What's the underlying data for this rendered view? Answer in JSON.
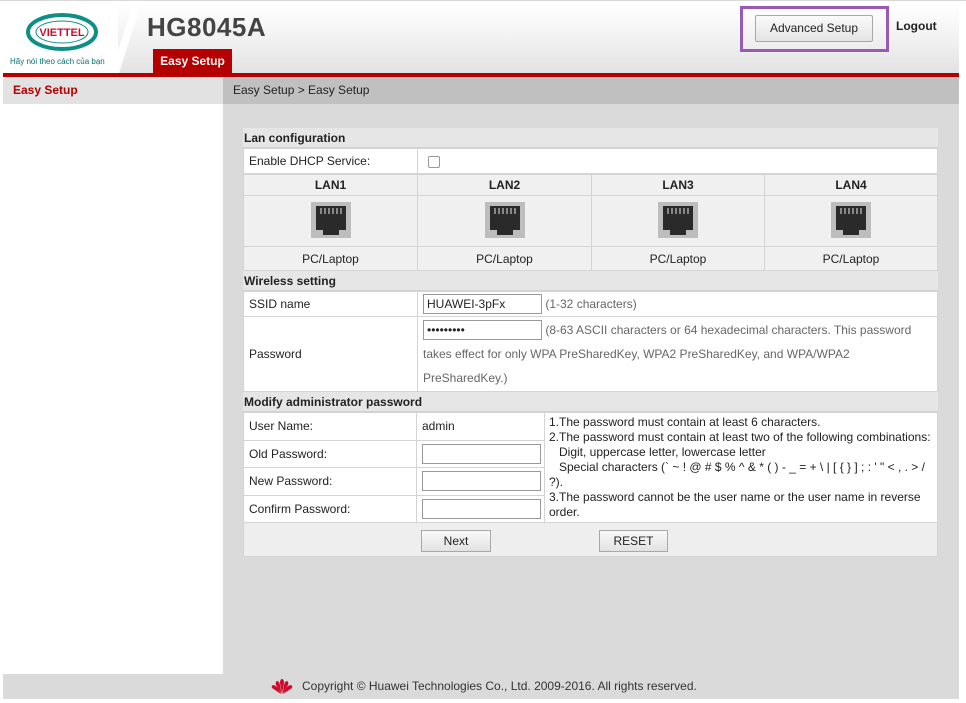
{
  "brand": {
    "logo_text": "VIETTEL",
    "slogan": "Hãy nói theo cách của bạn",
    "model": "HG8045A"
  },
  "tabs": [
    {
      "label": "Easy Setup",
      "active": true
    }
  ],
  "header_actions": {
    "advanced_setup_label": "Advanced Setup",
    "logout_label": "Logout"
  },
  "sidebar": {
    "items": [
      {
        "label": "Easy Setup",
        "active": true
      }
    ]
  },
  "breadcrumb": "Easy Setup > Easy Setup",
  "lan_config": {
    "title": "Lan configuration",
    "dhcp_label": "Enable DHCP Service:",
    "dhcp_checked": false,
    "ports": [
      {
        "name": "LAN1",
        "device": "PC/Laptop"
      },
      {
        "name": "LAN2",
        "device": "PC/Laptop"
      },
      {
        "name": "LAN3",
        "device": "PC/Laptop"
      },
      {
        "name": "LAN4",
        "device": "PC/Laptop"
      }
    ]
  },
  "wireless": {
    "title": "Wireless setting",
    "ssid_label": "SSID name",
    "ssid_value": "HUAWEI-3pFx",
    "ssid_hint": "(1-32 characters)",
    "password_label": "Password",
    "password_value": "•••••••••",
    "password_hint_1": "(8-63 ASCII characters or 64 hexadecimal characters. This password",
    "password_hint_2": "takes effect for only WPA PreSharedKey, WPA2 PreSharedKey, and WPA/WPA2",
    "password_hint_3": "PreSharedKey.)"
  },
  "admin": {
    "title": "Modify administrator password",
    "username_label": "User Name:",
    "username_value": "admin",
    "old_password_label": "Old Password:",
    "new_password_label": "New Password:",
    "confirm_password_label": "Confirm Password:",
    "rules": [
      "1.The password must contain at least 6 characters.",
      "2.The password must contain at least two of the following combinations:",
      "Digit, uppercase letter, lowercase letter",
      "Special characters (` ~ ! @ # $ % ^ & * ( ) - _ = + \\ | [ { } ] ; : ' \" < , . > /",
      "?).",
      "3.The password cannot be the user name or the user name in reverse",
      "order."
    ]
  },
  "buttons": {
    "next": "Next",
    "reset": "RESET"
  },
  "footer": {
    "copyright": "Copyright © Huawei Technologies Co., Ltd. 2009-2016. All rights reserved."
  },
  "colors": {
    "accent_red": "#b40000",
    "highlight_purple": "#9b59b6"
  },
  "icons": [
    "viettel-logo",
    "ethernet-port-icon",
    "huawei-logo-icon"
  ]
}
